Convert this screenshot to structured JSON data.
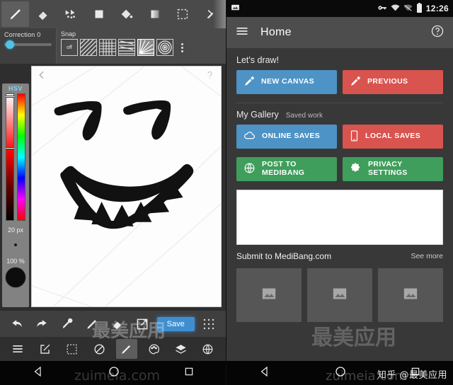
{
  "paint_app": {
    "tools": [
      {
        "name": "pencil-tool",
        "icon": "pencil-icon",
        "active": true
      },
      {
        "name": "eraser-tool",
        "icon": "eraser-icon",
        "active": false
      },
      {
        "name": "move-tool",
        "icon": "move-arrows-icon",
        "active": false
      },
      {
        "name": "fill-shape-tool",
        "icon": "square-fill-icon",
        "active": false
      },
      {
        "name": "bucket-tool",
        "icon": "paint-bucket-icon",
        "active": false
      },
      {
        "name": "gradient-tool",
        "icon": "gradient-icon",
        "active": false
      },
      {
        "name": "select-tool",
        "icon": "marquee-select-icon",
        "active": false
      },
      {
        "name": "more-tools",
        "icon": "chevron-right-icon",
        "active": false
      }
    ],
    "correction": {
      "label": "Correction 0",
      "value": 0
    },
    "snap": {
      "label": "Snap",
      "options": [
        {
          "name": "snap-off",
          "label": "off",
          "selected": false
        },
        {
          "name": "snap-parallel",
          "label": "",
          "selected": false
        },
        {
          "name": "snap-grid",
          "label": "",
          "selected": false
        },
        {
          "name": "snap-horizontal",
          "label": "",
          "selected": false
        },
        {
          "name": "snap-radial",
          "label": "",
          "selected": true
        },
        {
          "name": "snap-concentric",
          "label": "",
          "selected": false
        }
      ]
    },
    "color_panel": {
      "mode_label": "HSV",
      "brush_size": "20 px",
      "opacity": "100 %",
      "current_color": "#0d0d0d"
    },
    "bottom_tools": [
      {
        "name": "undo-button",
        "icon": "undo-arrow-icon"
      },
      {
        "name": "redo-button",
        "icon": "redo-arrow-icon"
      },
      {
        "name": "eyedropper-button",
        "icon": "eyedropper-icon"
      },
      {
        "name": "brush-button",
        "icon": "pencil-icon"
      },
      {
        "name": "eraser-button",
        "icon": "eraser-icon"
      },
      {
        "name": "transform-button",
        "icon": "external-link-icon"
      }
    ],
    "save_label": "Save",
    "grid_button": {
      "name": "grid-button",
      "icon": "grid-dots-icon"
    },
    "nav_tools": [
      {
        "name": "menu-button",
        "icon": "hamburger-icon",
        "highlight": false
      },
      {
        "name": "edit-button",
        "icon": "compose-icon",
        "highlight": false
      },
      {
        "name": "selection-button",
        "icon": "dashed-square-icon",
        "highlight": false
      },
      {
        "name": "flip-button",
        "icon": "flip-rotate-icon",
        "highlight": false
      },
      {
        "name": "brush-settings-button",
        "icon": "pencil-icon",
        "highlight": true
      },
      {
        "name": "palette-button",
        "icon": "palette-icon",
        "highlight": false
      },
      {
        "name": "layers-button",
        "icon": "layers-icon",
        "highlight": false
      },
      {
        "name": "globe-button",
        "icon": "globe-grid-icon",
        "highlight": false
      }
    ],
    "canvas": {
      "back_icon": "chevron-left-icon",
      "help_icon": "question-mark-icon",
      "artwork": "hand-drawn smiling face with toothy grin"
    },
    "android_nav": [
      {
        "name": "nav-back-button",
        "icon": "back-triangle-icon"
      },
      {
        "name": "nav-home-button",
        "icon": "home-circle-icon"
      },
      {
        "name": "nav-recents-button",
        "icon": "recents-square-icon"
      }
    ],
    "watermark_big": "最美应用",
    "watermark_url": "zuimeia.com"
  },
  "home_app": {
    "statusbar": {
      "left_icon": "image-notification-icon",
      "icons": [
        "vpn-key-icon",
        "wifi-icon",
        "signal-icon",
        "battery-icon"
      ],
      "time": "12:26"
    },
    "appbar": {
      "menu_icon": "hamburger-icon",
      "title": "Home",
      "help_icon": "question-mark-circle-icon"
    },
    "draw_section": {
      "title": "Let's draw!",
      "buttons": [
        {
          "name": "new-canvas-button",
          "label": "NEW CANVAS",
          "icon": "brush-icon",
          "color": "#4d93c6"
        },
        {
          "name": "previous-button",
          "label": "PREVIOUS",
          "icon": "brush-icon",
          "color": "#d9534f"
        }
      ]
    },
    "gallery_section": {
      "title": "My Gallery",
      "subtitle": "Saved work",
      "buttons": [
        {
          "name": "online-saves-button",
          "label": "ONLINE SAVES",
          "icon": "cloud-icon",
          "color": "#4d93c6"
        },
        {
          "name": "local-saves-button",
          "label": "LOCAL SAVES",
          "icon": "phone-icon",
          "color": "#d9534f"
        },
        {
          "name": "post-to-medibang-button",
          "label": "POST TO\nMEDIBANG",
          "icon": "globe-icon",
          "color": "#3f9e5c"
        },
        {
          "name": "privacy-settings-button",
          "label": "PRIVACY\nSETTINGS",
          "icon": "gear-icon",
          "color": "#3f9e5c"
        }
      ]
    },
    "submit_row": {
      "text": "Submit to MediBang.com",
      "see_more": "See more"
    },
    "thumbnails": [
      {
        "name": "gallery-thumbnail-1",
        "icon": "image-placeholder-icon"
      },
      {
        "name": "gallery-thumbnail-2",
        "icon": "image-placeholder-icon"
      },
      {
        "name": "gallery-thumbnail-3",
        "icon": "image-placeholder-icon"
      }
    ],
    "android_nav": [
      {
        "name": "nav-back-button",
        "icon": "back-triangle-icon"
      },
      {
        "name": "nav-home-button",
        "icon": "home-circle-icon"
      },
      {
        "name": "nav-recents-button",
        "icon": "recents-square-icon"
      }
    ],
    "watermark": "知乎 @最美应用",
    "watermark_big": "最美应用",
    "watermark_url": "zuimeia.com"
  }
}
